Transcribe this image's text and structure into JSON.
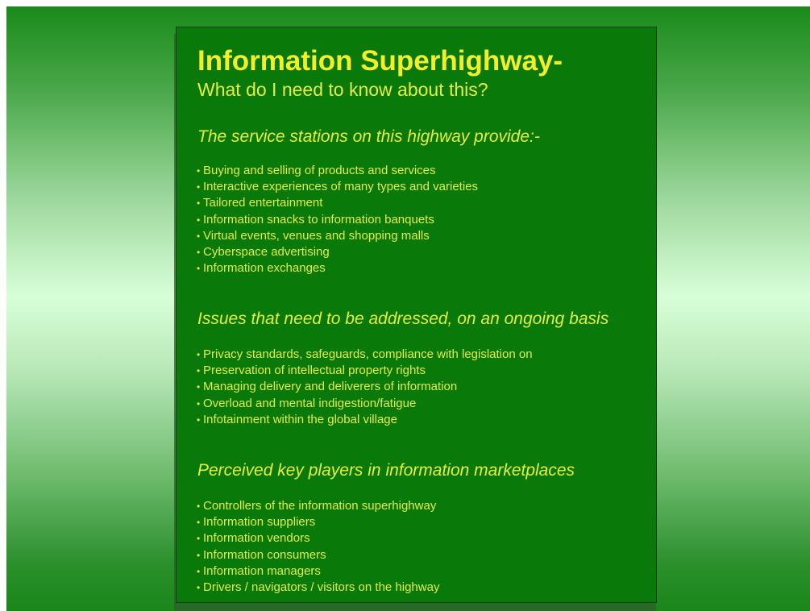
{
  "slide": {
    "title": "Information Superhighway-",
    "subtitle": "What do I need to know about this?",
    "sections": [
      {
        "heading": "The service stations on this highway provide:-",
        "items": [
          "Buying and selling of products and services",
          "Interactive experiences of many types and varieties",
          "Tailored entertainment",
          "Information snacks to information banquets",
          "Virtual events, venues and shopping malls",
          "Cyberspace advertising",
          "Information exchanges"
        ]
      },
      {
        "heading": "Issues that need to be addressed, on an ongoing basis",
        "items": [
          "Privacy standards, safeguards, compliance with legislation on",
          "Preservation of intellectual property rights",
          "Managing delivery and deliverers of information",
          "Overload and mental indigestion/fatigue",
          "Infotainment within the global village"
        ]
      },
      {
        "heading": "Perceived key players in information marketplaces",
        "items": [
          "Controllers of the information superhighway",
          "Information suppliers",
          "Information vendors",
          "Information consumers",
          "Information managers",
          "Drivers / navigators / visitors on the highway"
        ]
      }
    ],
    "bullet_symbol": "•",
    "colors": {
      "panel_background": "#097a09",
      "text": "#e6ee3a",
      "title": "#f2ef2a"
    }
  }
}
